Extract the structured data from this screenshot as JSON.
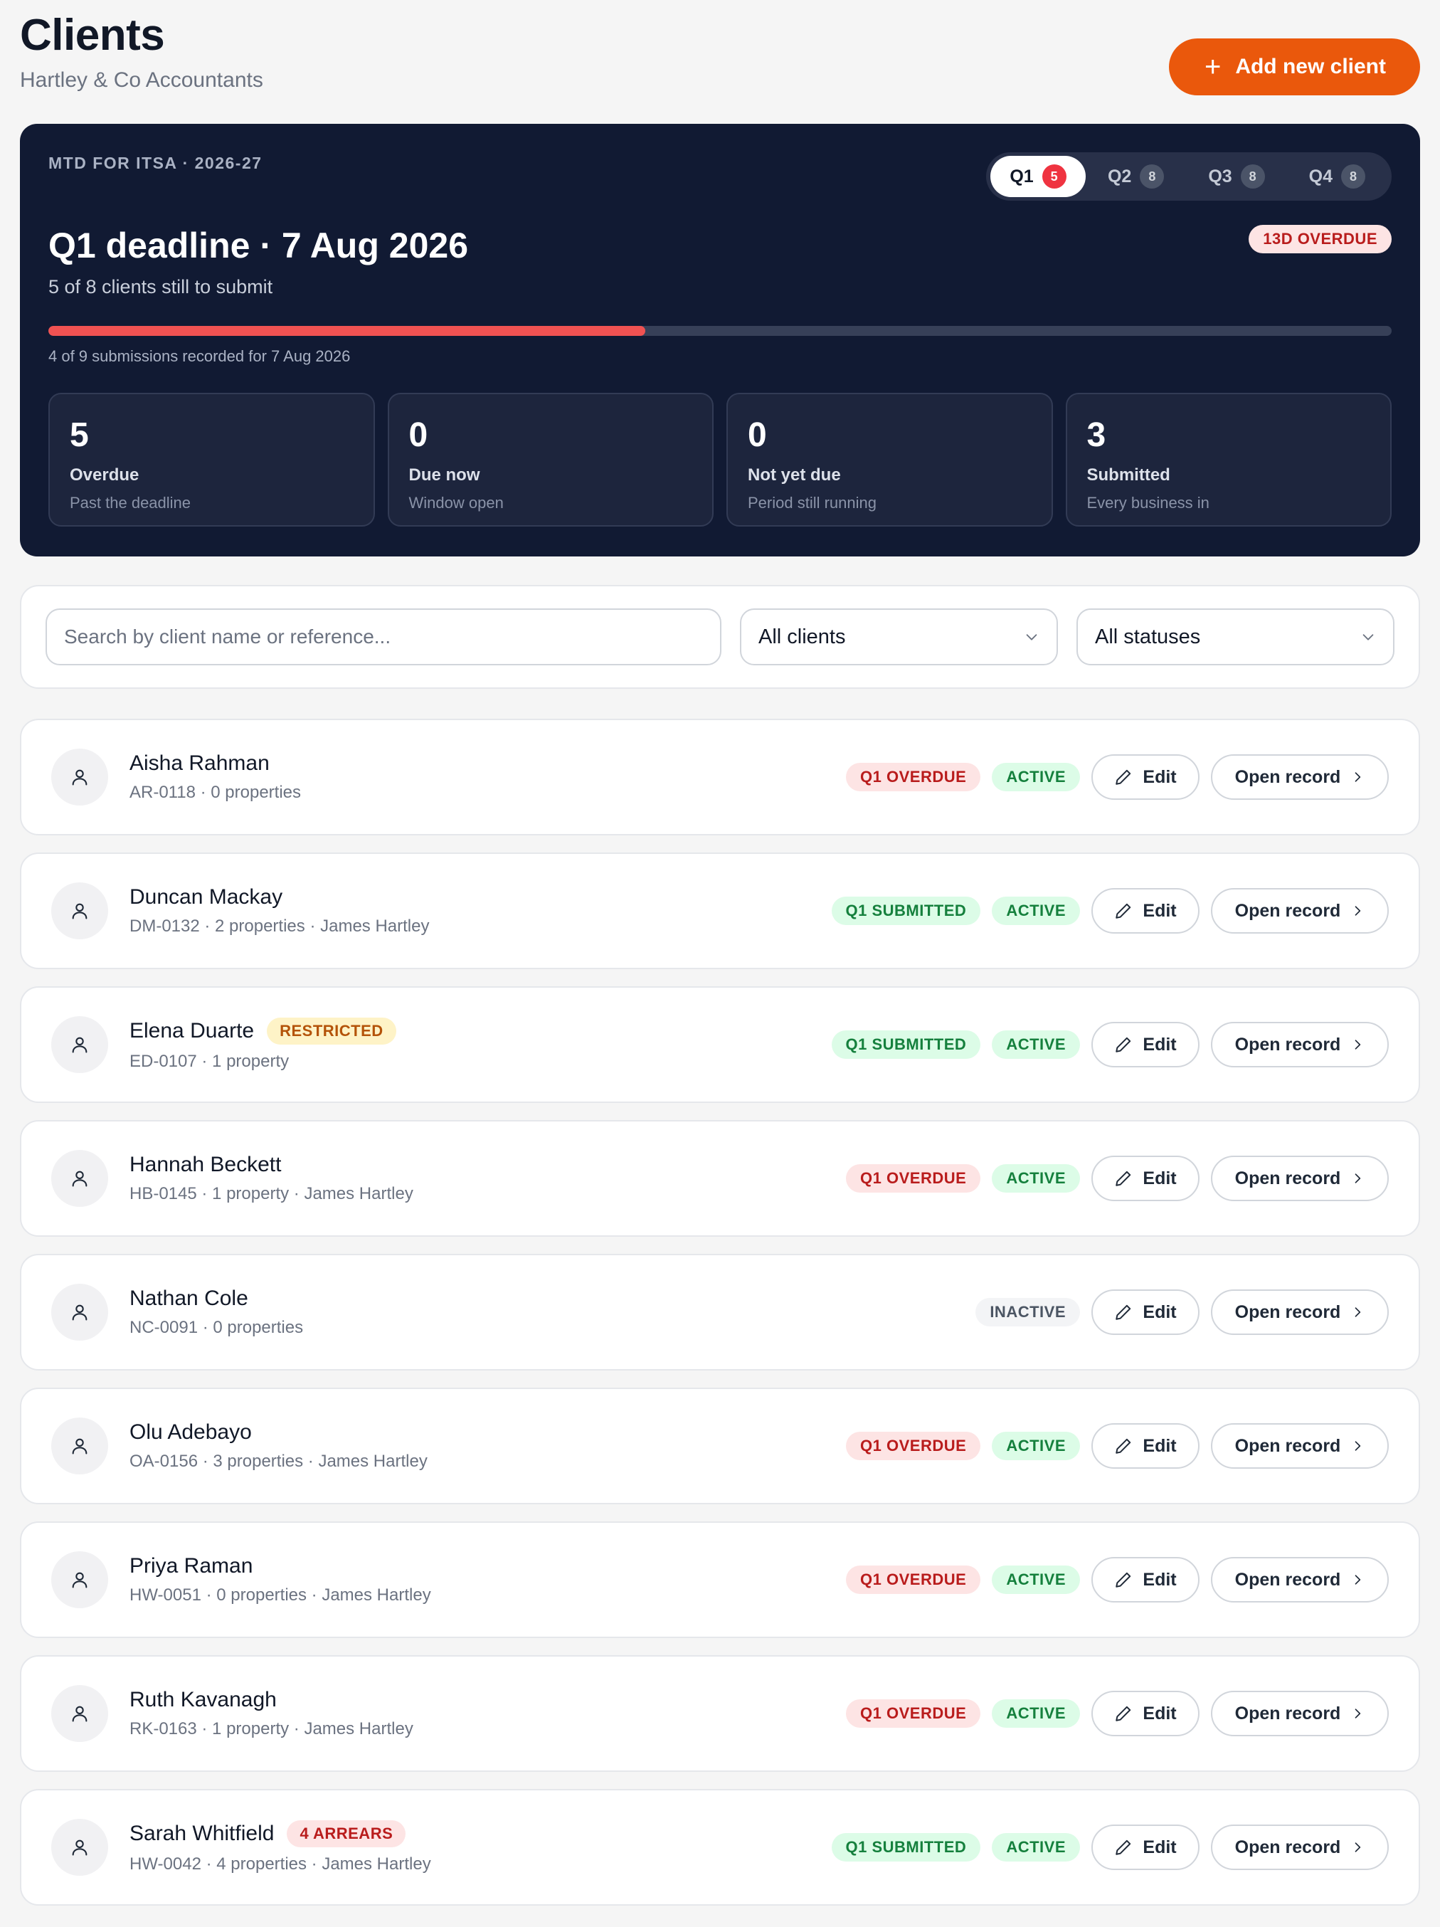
{
  "header": {
    "title": "Clients",
    "subtitle": "Hartley & Co Accountants",
    "add_button_label": "Add new client"
  },
  "summary": {
    "eyebrow": "MTD FOR ITSA · 2026-27",
    "quarters": [
      {
        "label": "Q1",
        "count": "5",
        "active": true
      },
      {
        "label": "Q2",
        "count": "8",
        "active": false
      },
      {
        "label": "Q3",
        "count": "8",
        "active": false
      },
      {
        "label": "Q4",
        "count": "8",
        "active": false
      }
    ],
    "overdue_badge": "13D OVERDUE",
    "deadline_title": "Q1 deadline · 7 Aug 2026",
    "deadline_subtitle": "5 of 8 clients still to submit",
    "progress_fraction": 0.4444,
    "progress_caption": "4 of 9 submissions recorded for 7 Aug 2026",
    "stats": [
      {
        "value": "5",
        "label": "Overdue",
        "sub": "Past the deadline"
      },
      {
        "value": "0",
        "label": "Due now",
        "sub": "Window open"
      },
      {
        "value": "0",
        "label": "Not yet due",
        "sub": "Period still running"
      },
      {
        "value": "3",
        "label": "Submitted",
        "sub": "Every business in"
      }
    ]
  },
  "filters": {
    "search_placeholder": "Search by client name or reference...",
    "client_filter": "All clients",
    "status_filter": "All statuses"
  },
  "actions": {
    "edit_label": "Edit",
    "open_label": "Open record"
  },
  "clients": [
    {
      "name": "Aisha Rahman",
      "meta": "AR-0118 · 0 properties",
      "flag": "",
      "flag_type": "",
      "quarter_status": "Q1 OVERDUE",
      "quarter_type": "overdue",
      "account_status": "ACTIVE",
      "account_type": "active"
    },
    {
      "name": "Duncan Mackay",
      "meta": "DM-0132 · 2 properties · James Hartley",
      "flag": "",
      "flag_type": "",
      "quarter_status": "Q1 SUBMITTED",
      "quarter_type": "submitted",
      "account_status": "ACTIVE",
      "account_type": "active"
    },
    {
      "name": "Elena Duarte",
      "meta": "ED-0107 · 1 property",
      "flag": "RESTRICTED",
      "flag_type": "restricted",
      "quarter_status": "Q1 SUBMITTED",
      "quarter_type": "submitted",
      "account_status": "ACTIVE",
      "account_type": "active"
    },
    {
      "name": "Hannah Beckett",
      "meta": "HB-0145 · 1 property · James Hartley",
      "flag": "",
      "flag_type": "",
      "quarter_status": "Q1 OVERDUE",
      "quarter_type": "overdue",
      "account_status": "ACTIVE",
      "account_type": "active"
    },
    {
      "name": "Nathan Cole",
      "meta": "NC-0091 · 0 properties",
      "flag": "",
      "flag_type": "",
      "quarter_status": "",
      "quarter_type": "",
      "account_status": "INACTIVE",
      "account_type": "inactive"
    },
    {
      "name": "Olu Adebayo",
      "meta": "OA-0156 · 3 properties · James Hartley",
      "flag": "",
      "flag_type": "",
      "quarter_status": "Q1 OVERDUE",
      "quarter_type": "overdue",
      "account_status": "ACTIVE",
      "account_type": "active"
    },
    {
      "name": "Priya Raman",
      "meta": "HW-0051 · 0 properties · James Hartley",
      "flag": "",
      "flag_type": "",
      "quarter_status": "Q1 OVERDUE",
      "quarter_type": "overdue",
      "account_status": "ACTIVE",
      "account_type": "active"
    },
    {
      "name": "Ruth Kavanagh",
      "meta": "RK-0163 · 1 property · James Hartley",
      "flag": "",
      "flag_type": "",
      "quarter_status": "Q1 OVERDUE",
      "quarter_type": "overdue",
      "account_status": "ACTIVE",
      "account_type": "active"
    },
    {
      "name": "Sarah Whitfield",
      "meta": "HW-0042 · 4 properties · James Hartley",
      "flag": "4 ARREARS",
      "flag_type": "arrears",
      "quarter_status": "Q1 SUBMITTED",
      "quarter_type": "submitted",
      "account_status": "ACTIVE",
      "account_type": "active"
    }
  ],
  "icons": {
    "add": "plus-icon",
    "avatar": "user-icon",
    "edit": "pencil-icon",
    "open": "chevron-right-icon",
    "select": "chevron-down-icon"
  },
  "colors": {
    "accent": "#ea580c",
    "summary_bg": "#111a33",
    "overdue": "#b91c1c",
    "success": "#15803d",
    "warning": "#b45309"
  }
}
